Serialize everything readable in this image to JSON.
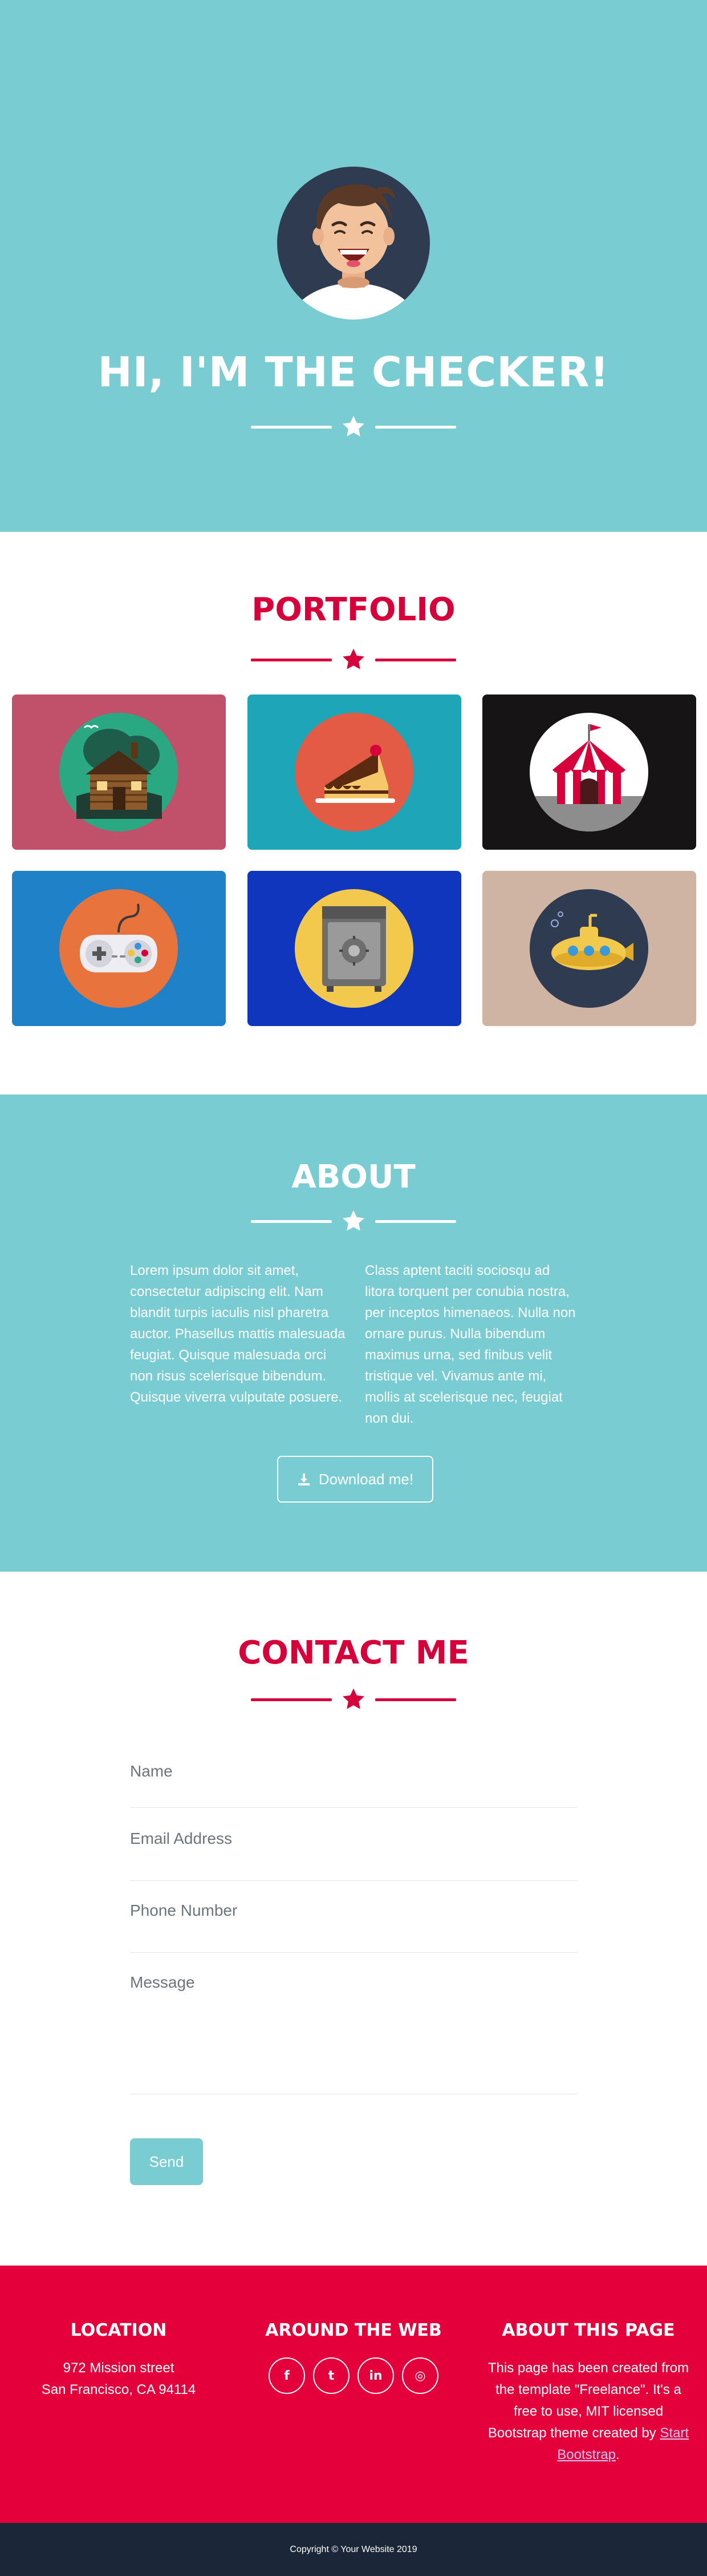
{
  "masthead": {
    "title": "HI, I'M THE CHECKER!",
    "avatar_icon": "person-avatar-icon",
    "divider_icon": "star-icon",
    "background": "#79ccd2"
  },
  "portfolio": {
    "title": "PORTFOLIO",
    "divider_icon": "star-icon",
    "items": [
      {
        "icon": "cabin-icon",
        "color": "#c1506b"
      },
      {
        "icon": "cake-icon",
        "color": "#1ea6b8"
      },
      {
        "icon": "circus-tent-icon",
        "color": "#161414"
      },
      {
        "icon": "game-controller-icon",
        "color": "#1f82c8"
      },
      {
        "icon": "safe-icon",
        "color": "#1036be"
      },
      {
        "icon": "submarine-icon",
        "color": "#cfb3a3"
      }
    ]
  },
  "about": {
    "title": "ABOUT",
    "divider_icon": "star-icon",
    "column_left": "Lorem ipsum dolor sit amet, consectetur adipiscing elit. Nam blandit turpis iaculis nisl pharetra auctor. Phasellus mattis malesuada feugiat. Quisque malesuada orci non risus scelerisque bibendum. Quisque viverra vulputate posuere.",
    "column_right": "Class aptent taciti sociosqu ad litora torquent per conubia nostra, per inceptos himenaeos. Nulla non ornare purus. Nulla bibendum maximus urna, sed finibus velit tristique vel. Vivamus ante mi, mollis at scelerisque nec, feugiat non dui.",
    "download_label": "Download me!",
    "download_icon": "download-icon"
  },
  "contact": {
    "title": "CONTACT ME",
    "divider_icon": "star-icon",
    "name_placeholder": "Name",
    "email_placeholder": "Email Address",
    "phone_placeholder": "Phone Number",
    "message_placeholder": "Message",
    "send_label": "Send"
  },
  "footer": {
    "location": {
      "title": "LOCATION",
      "line1": "972 Mission street",
      "line2": "San Francisco, CA 94114"
    },
    "around": {
      "title": "AROUND THE WEB",
      "links": [
        {
          "icon": "facebook-icon",
          "glyph": "f"
        },
        {
          "icon": "twitter-icon",
          "glyph": "t"
        },
        {
          "icon": "linkedin-icon",
          "glyph": "in"
        },
        {
          "icon": "dribbble-icon",
          "glyph": "◎"
        }
      ]
    },
    "about_page": {
      "title": "ABOUT THIS PAGE",
      "text": "This page has been created from the template \"Freelance\". It's a free to use, MIT licensed Bootstrap theme created by",
      "link_text": "Start Bootstrap",
      "suffix": "."
    }
  },
  "copyright": "Copyright © Your Website 2019"
}
